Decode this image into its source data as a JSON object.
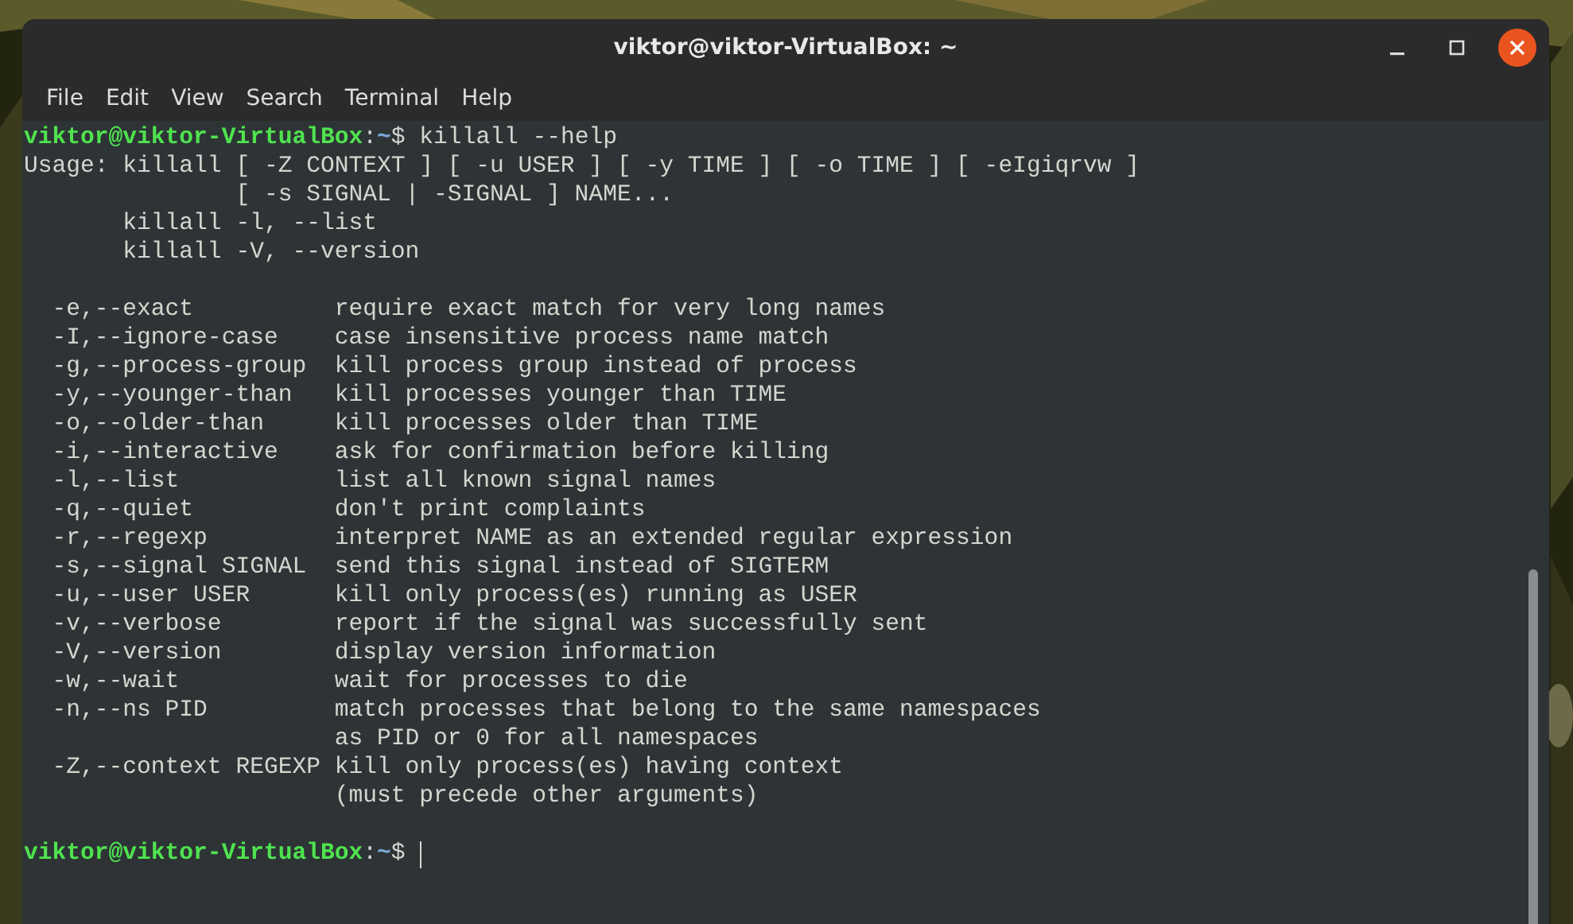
{
  "window": {
    "title": "viktor@viktor-VirtualBox: ~",
    "controls": [
      {
        "kind": "minimize"
      },
      {
        "kind": "maximize"
      },
      {
        "kind": "close"
      }
    ]
  },
  "menu": [
    "File",
    "Edit",
    "View",
    "Search",
    "Terminal",
    "Help"
  ],
  "terminal": {
    "lines": [
      {
        "kind": "prompt",
        "user_host": "viktor@viktor-VirtualBox",
        "separator": ":",
        "path": "~",
        "symbol": "$",
        "command": " killall --help"
      },
      {
        "kind": "output",
        "text": "Usage: killall [ -Z CONTEXT ] [ -u USER ] [ -y TIME ] [ -o TIME ] [ -eIgiqrvw ]"
      },
      {
        "kind": "output",
        "text": "               [ -s SIGNAL | -SIGNAL ] NAME..."
      },
      {
        "kind": "output",
        "text": "       killall -l, --list"
      },
      {
        "kind": "output",
        "text": "       killall -V, --version"
      },
      {
        "kind": "blank"
      },
      {
        "kind": "output",
        "text": "  -e,--exact          require exact match for very long names"
      },
      {
        "kind": "output",
        "text": "  -I,--ignore-case    case insensitive process name match"
      },
      {
        "kind": "output",
        "text": "  -g,--process-group  kill process group instead of process"
      },
      {
        "kind": "output",
        "text": "  -y,--younger-than   kill processes younger than TIME"
      },
      {
        "kind": "output",
        "text": "  -o,--older-than     kill processes older than TIME"
      },
      {
        "kind": "output",
        "text": "  -i,--interactive    ask for confirmation before killing"
      },
      {
        "kind": "output",
        "text": "  -l,--list           list all known signal names"
      },
      {
        "kind": "output",
        "text": "  -q,--quiet          don't print complaints"
      },
      {
        "kind": "output",
        "text": "  -r,--regexp         interpret NAME as an extended regular expression"
      },
      {
        "kind": "output",
        "text": "  -s,--signal SIGNAL  send this signal instead of SIGTERM"
      },
      {
        "kind": "output",
        "text": "  -u,--user USER      kill only process(es) running as USER"
      },
      {
        "kind": "output",
        "text": "  -v,--verbose        report if the signal was successfully sent"
      },
      {
        "kind": "output",
        "text": "  -V,--version        display version information"
      },
      {
        "kind": "output",
        "text": "  -w,--wait           wait for processes to die"
      },
      {
        "kind": "output",
        "text": "  -n,--ns PID         match processes that belong to the same namespaces"
      },
      {
        "kind": "output",
        "text": "                      as PID or 0 for all namespaces"
      },
      {
        "kind": "output",
        "text": "  -Z,--context REGEXP kill only process(es) having context"
      },
      {
        "kind": "output",
        "text": "                      (must precede other arguments)"
      },
      {
        "kind": "blank"
      },
      {
        "kind": "prompt",
        "user_host": "viktor@viktor-VirtualBox",
        "separator": ":",
        "path": "~",
        "symbol": "$",
        "cursor": true
      }
    ]
  }
}
